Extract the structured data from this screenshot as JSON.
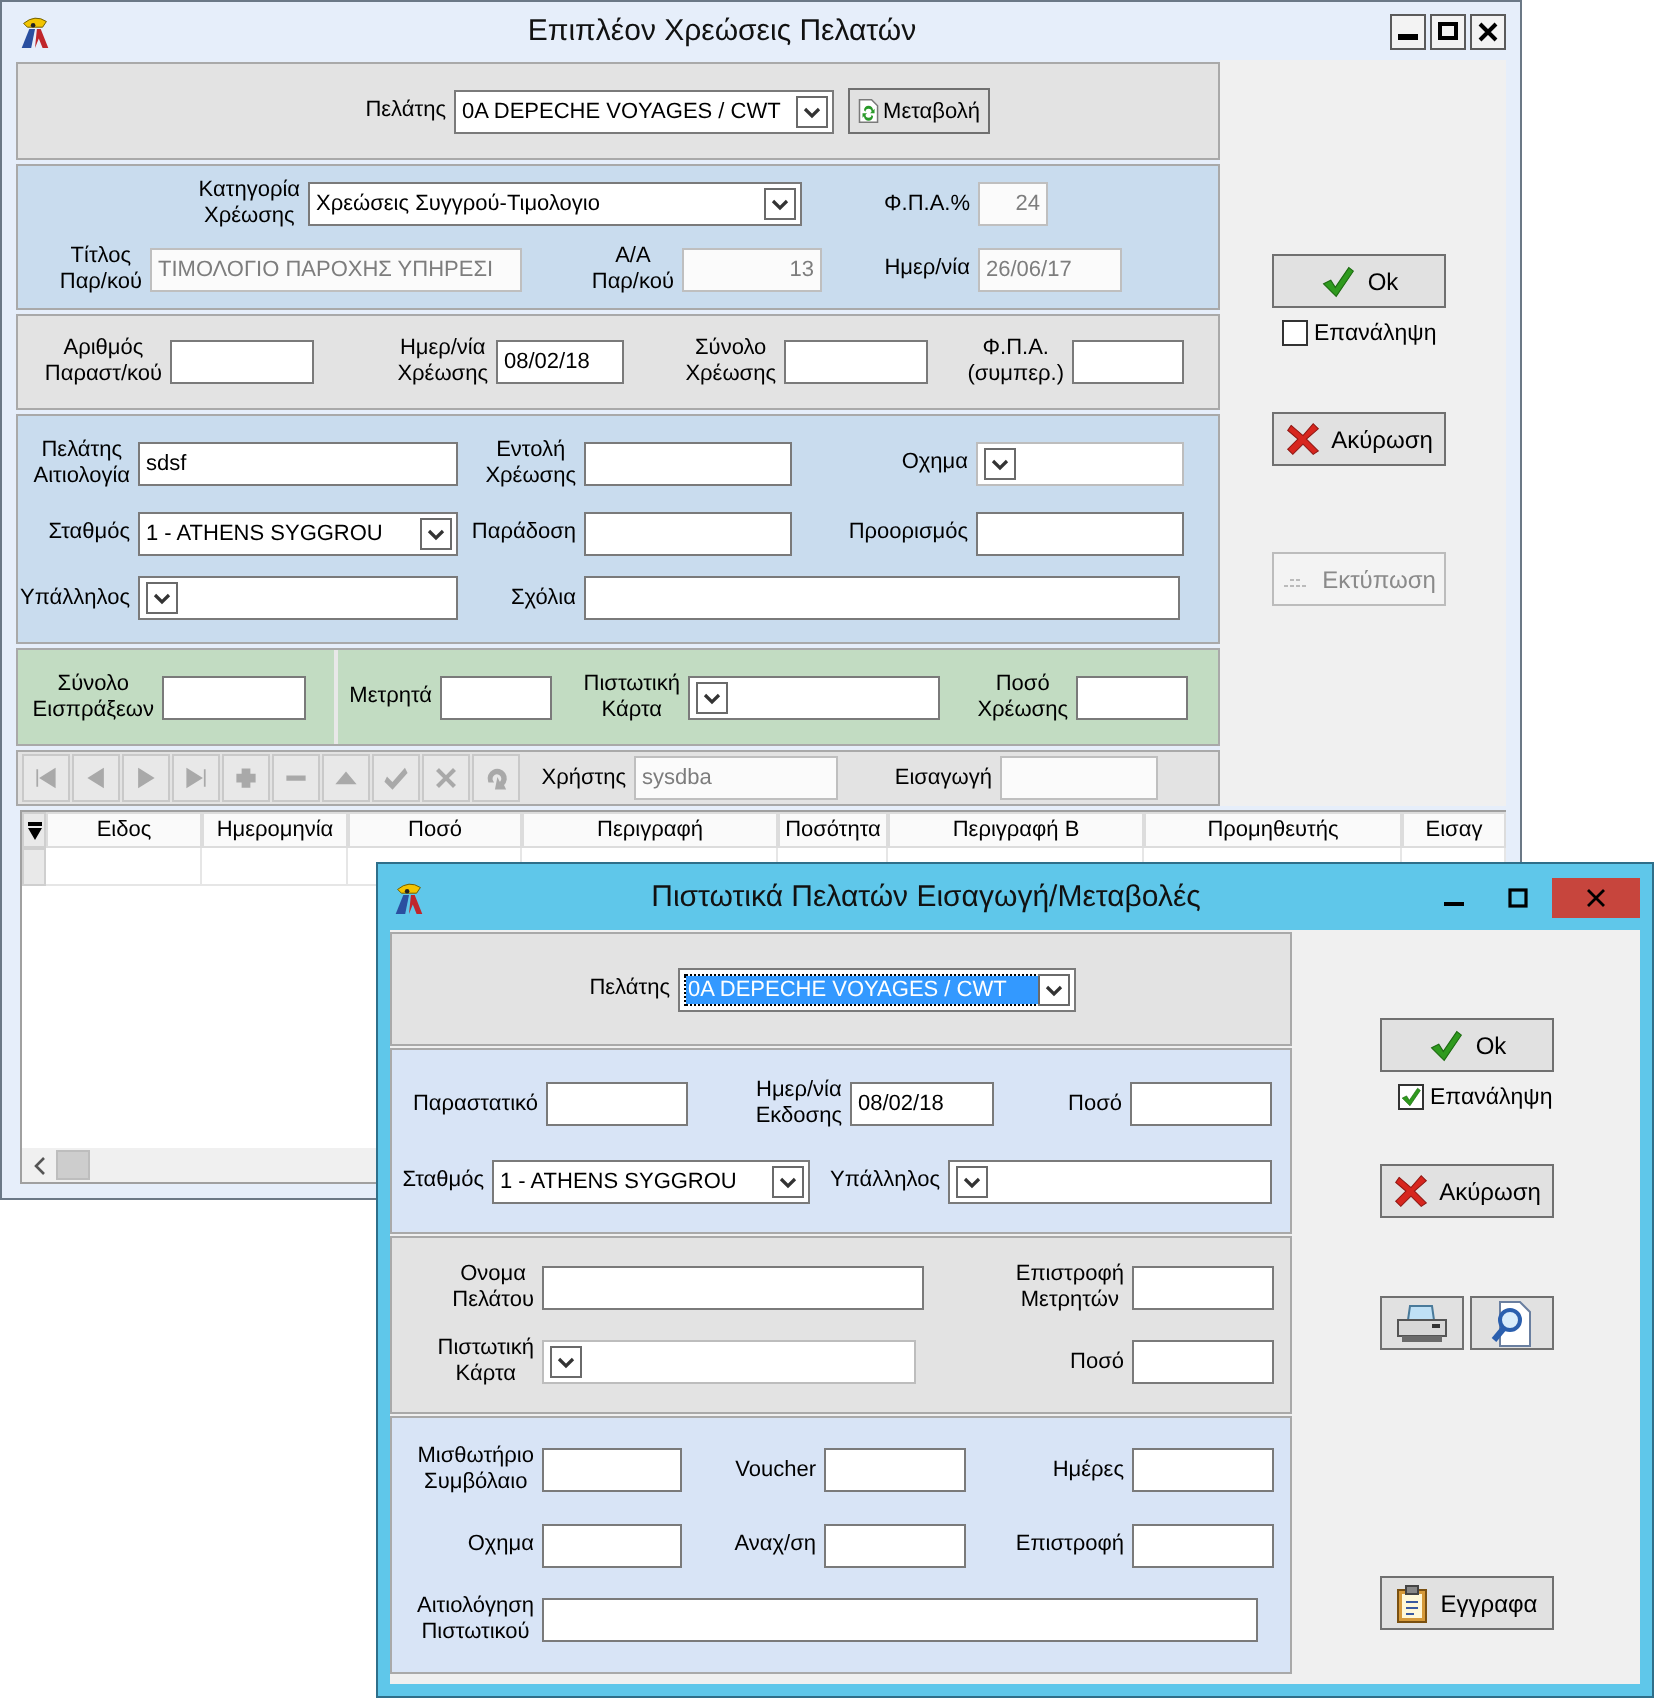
{
  "main_window": {
    "title": "Επιπλέον Χρεώσεις Πελατών",
    "sections": [
      {
        "kind": "gray",
        "panels": [
          {
            "rows": [
              [
                {
                  "kind": "combo",
                  "label": "Πελάτης",
                  "value": "0A DEPECHE VOYAGES / CWT",
                  "disabled": false,
                  "selected": false
                },
                {
                  "kind": "button",
                  "label": "Μεταβολή",
                  "disabled": false
                }
              ]
            ]
          }
        ]
      },
      {
        "kind": "blue",
        "panels": [
          {
            "rows": [
              [
                {
                  "kind": "combo",
                  "label": "Κατηγορία\nΧρέωσης",
                  "value": "Χρεώσεις Συγγρού-Τιμολογιο",
                  "disabled": false,
                  "selected": false
                },
                "",
                {
                  "kind": "number",
                  "label": "Φ.Π.Α.%",
                  "value": "24",
                  "disabled": true
                }
              ],
              [
                {
                  "kind": "text",
                  "label": "Τίτλος\nΠαρ/κού",
                  "value": "ΤΙΜΟΛΟΓΙΟ ΠΑΡΟΧΗΣ ΥΠΗΡΕΣΙ",
                  "disabled": true
                },
                {
                  "kind": "number",
                  "label": "Α/Α\nΠαρ/κού",
                  "value": "13",
                  "disabled": true
                },
                {
                  "kind": "text",
                  "label": "Ημερ/νία",
                  "value": "26/06/17",
                  "disabled": true
                }
              ]
            ]
          }
        ]
      },
      {
        "kind": "gray",
        "panels": [
          {
            "rows": [
              [
                {
                  "kind": "text",
                  "label": "Αριθμός\nΠαραστ/κού",
                  "disabled": false
                },
                {
                  "kind": "text",
                  "label": "Ημερ/νία\nΧρέωσης",
                  "value": "08/02/18",
                  "disabled": false
                },
                {
                  "kind": "text",
                  "label": "Σύνολο\nΧρέωσης",
                  "disabled": false
                },
                {
                  "kind": "text",
                  "label": "Φ.Π.Α.\n(συμπερ.)",
                  "disabled": false
                }
              ]
            ]
          }
        ]
      },
      {
        "kind": "blue",
        "panels": [
          {
            "rows": [
              [
                {
                  "kind": "text",
                  "label": "Πελάτης\nΑιτιολογία",
                  "value": "sdsf",
                  "disabled": false
                },
                {
                  "kind": "text",
                  "label": "Εντολή\nΧρέωσης",
                  "disabled": false
                },
                {
                  "kind": "combo",
                  "label": "Οχημα",
                  "disabled": true,
                  "selected": false
                }
              ],
              [
                {
                  "kind": "combo",
                  "label": "Σταθμός",
                  "value": "1 - ATHENS SYGGROU",
                  "disabled": false,
                  "selected": false
                },
                {
                  "kind": "text",
                  "label": "Παράδοση",
                  "disabled": false
                },
                {
                  "kind": "text",
                  "label": "Προορισμός",
                  "disabled": false
                }
              ],
              [
                {
                  "kind": "combo",
                  "label": "Υπάλληλος",
                  "disabled": false,
                  "selected": false
                },
                {
                  "kind": "text",
                  "label": "Σχόλια",
                  "disabled": false
                }
              ]
            ]
          }
        ]
      },
      {
        "kind": "green",
        "panels": [
          {
            "rows": [
              [
                {
                  "kind": "text",
                  "label": "Σύνολο\nΕισπράξεων",
                  "disabled": false
                }
              ]
            ]
          },
          {
            "rows": [
              [
                {
                  "kind": "text",
                  "label": "Μετρητά",
                  "disabled": false
                },
                {
                  "kind": "combo",
                  "label": "Πιστωτική\nΚάρτα",
                  "disabled": false,
                  "selected": false
                },
                {
                  "kind": "text",
                  "label": "Ποσό\nΧρέωσης",
                  "disabled": false
                }
              ]
            ]
          }
        ]
      }
    ],
    "toolbar": {
      "nav_buttons": [
        {
          "disabled": true
        },
        {
          "disabled": true
        },
        {
          "disabled": true
        },
        {
          "disabled": true
        },
        {
          "disabled": true
        },
        {
          "disabled": true
        },
        {
          "disabled": true
        },
        {
          "disabled": true
        },
        {
          "disabled": true
        },
        {
          "disabled": true
        }
      ],
      "fields": [
        {
          "kind": "text",
          "label": "Χρήστης",
          "value": "sysdba",
          "disabled": true
        },
        {
          "kind": "text",
          "label": "Εισαγωγή",
          "disabled": true
        }
      ]
    },
    "grid": {
      "columns": [
        "Ειδος",
        "Ημερομηνία",
        "Ποσό",
        "Περιγραφή",
        "Ποσότητα",
        "Περιγραφή Β",
        "Προμηθευτής",
        "Εισαγ"
      ]
    },
    "side": [
      {
        "kind": "ok",
        "label": "Ok",
        "disabled": false
      },
      {
        "kind": "checkbox",
        "label": "Επανάληψη",
        "checked": false
      },
      {
        "kind": "cancel",
        "label": "Ακύρωση",
        "disabled": false
      },
      {
        "kind": "print",
        "label": "Εκτύπωση",
        "disabled": true
      }
    ]
  },
  "dialog": {
    "title": "Πιστωτικά Πελατών Εισαγωγή/Μεταβολές",
    "sections": [
      {
        "kind": "gray",
        "panels": [
          {
            "rows": [
              [
                {
                  "kind": "combo",
                  "label": "Πελάτης",
                  "value": "0A DEPECHE VOYAGES / CWT",
                  "disabled": false,
                  "selected": true
                }
              ]
            ]
          }
        ]
      },
      {
        "kind": "lightblue",
        "panels": [
          {
            "rows": [
              [
                {
                  "kind": "text",
                  "label": "Παραστατικό",
                  "disabled": false
                },
                {
                  "kind": "text",
                  "label": "Ημερ/νία\nΕκδοσης",
                  "value": "08/02/18",
                  "disabled": false
                },
                {
                  "kind": "text",
                  "label": "Ποσό",
                  "disabled": false
                }
              ],
              [
                {
                  "kind": "combo",
                  "label": "Σταθμός",
                  "value": "1 - ATHENS SYGGROU",
                  "disabled": false,
                  "selected": false
                },
                {
                  "kind": "combo",
                  "label": "Υπάλληλος",
                  "disabled": false,
                  "selected": false
                }
              ]
            ]
          }
        ]
      },
      {
        "kind": "gray",
        "panels": [
          {
            "rows": [
              [
                {
                  "kind": "text",
                  "label": "Ονομα\nΠελάτου",
                  "disabled": false
                },
                {
                  "kind": "text",
                  "label": "Επιστροφή\nΜετρητών",
                  "disabled": false
                }
              ],
              [
                {
                  "kind": "combo",
                  "label": "Πιστωτική\nΚάρτα",
                  "disabled": true,
                  "selected": false
                },
                {
                  "kind": "text",
                  "label": "Ποσό",
                  "disabled": false
                }
              ]
            ]
          }
        ]
      },
      {
        "kind": "lightblue",
        "panels": [
          {
            "rows": [
              [
                {
                  "kind": "text",
                  "label": "Μισθωτήριο\nΣυμβόλαιο",
                  "disabled": false
                },
                {
                  "kind": "text",
                  "label": "Voucher",
                  "disabled": false
                },
                {
                  "kind": "text",
                  "label": "Ημέρες",
                  "disabled": false
                }
              ],
              [
                {
                  "kind": "text",
                  "label": "Οχημα",
                  "disabled": false
                },
                {
                  "kind": "text",
                  "label": "Αναχ/ση",
                  "disabled": false
                },
                {
                  "kind": "text",
                  "label": "Επιστροφή",
                  "disabled": false
                }
              ],
              [
                {
                  "kind": "text",
                  "label": "Αιτιολόγηση\nΠιστωτικού",
                  "disabled": false
                }
              ]
            ]
          }
        ]
      }
    ],
    "side": [
      {
        "kind": "ok",
        "label": "Ok",
        "disabled": false
      },
      {
        "kind": "checkbox",
        "label": "Επανάληψη",
        "checked": true
      },
      {
        "kind": "cancel",
        "label": "Ακύρωση",
        "disabled": false
      },
      {
        "kind": "print_preview",
        "disabled": false
      },
      {
        "kind": "documents",
        "label": "Εγγραφα",
        "disabled": false
      }
    ]
  }
}
